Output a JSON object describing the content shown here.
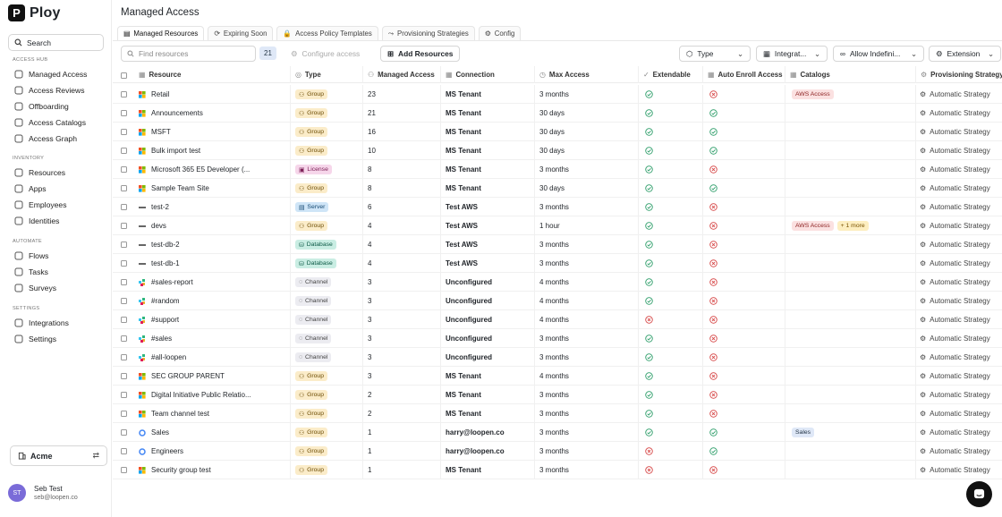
{
  "app": {
    "name": "Ploy",
    "logo_letter": "P"
  },
  "sidebar": {
    "search_label": "Search",
    "sections": [
      {
        "title": "ACCESS HUB",
        "items": [
          {
            "label": "Managed Access",
            "icon": "shield-icon"
          },
          {
            "label": "Access Reviews",
            "icon": "check-circle-icon"
          },
          {
            "label": "Offboarding",
            "icon": "logout-icon"
          },
          {
            "label": "Access Catalogs",
            "icon": "grid-icon"
          },
          {
            "label": "Access Graph",
            "icon": "graph-icon"
          }
        ]
      },
      {
        "title": "INVENTORY",
        "items": [
          {
            "label": "Resources",
            "icon": "box-icon"
          },
          {
            "label": "Apps",
            "icon": "apps-icon"
          },
          {
            "label": "Employees",
            "icon": "users-icon"
          },
          {
            "label": "Identities",
            "icon": "id-icon"
          }
        ]
      },
      {
        "title": "AUTOMATE",
        "items": [
          {
            "label": "Flows",
            "icon": "flow-icon"
          },
          {
            "label": "Tasks",
            "icon": "list-icon"
          },
          {
            "label": "Surveys",
            "icon": "survey-icon"
          }
        ]
      },
      {
        "title": "SETTINGS",
        "items": [
          {
            "label": "Integrations",
            "icon": "plug-icon"
          },
          {
            "label": "Settings",
            "icon": "gear-icon"
          }
        ]
      }
    ],
    "org": "Acme",
    "user": {
      "initials": "ST",
      "name": "Seb Test",
      "email": "seb@loopen.co"
    }
  },
  "page": {
    "title": "Managed Access"
  },
  "tabs": [
    "Managed Resources",
    "Expiring Soon",
    "Access Policy Templates",
    "Provisioning Strategies",
    "Config"
  ],
  "toolbar": {
    "find_placeholder": "Find resources",
    "count": "21",
    "configure_label": "Configure access",
    "add_label": "Add Resources",
    "filters": [
      "Type",
      "Integrat...",
      "Allow Indefini...",
      "Extension"
    ]
  },
  "columns": [
    "Resource",
    "Type",
    "Managed Access",
    "Connection",
    "Max Access",
    "Extendable",
    "Auto Enroll Access",
    "Catalogs",
    "Provisioning Strategy"
  ],
  "rows": [
    {
      "name": "Retail",
      "src": "ms",
      "type": "Group",
      "count": "23",
      "conn": "MS Tenant",
      "max": "3 months",
      "ext": true,
      "auto": false,
      "tags": [
        {
          "t": "AWS Access",
          "c": "red"
        }
      ],
      "prov": "Automatic Strategy"
    },
    {
      "name": "Announcements",
      "src": "ms",
      "type": "Group",
      "count": "21",
      "conn": "MS Tenant",
      "max": "30 days",
      "ext": true,
      "auto": true,
      "tags": [],
      "prov": "Automatic Strategy"
    },
    {
      "name": "MSFT",
      "src": "ms",
      "type": "Group",
      "count": "16",
      "conn": "MS Tenant",
      "max": "30 days",
      "ext": true,
      "auto": true,
      "tags": [],
      "prov": "Automatic Strategy"
    },
    {
      "name": "Bulk import test",
      "src": "ms",
      "type": "Group",
      "count": "10",
      "conn": "MS Tenant",
      "max": "30 days",
      "ext": true,
      "auto": true,
      "tags": [],
      "prov": "Automatic Strategy"
    },
    {
      "name": "Microsoft 365 E5 Developer (...",
      "src": "ms",
      "type": "License",
      "count": "8",
      "conn": "MS Tenant",
      "max": "3 months",
      "ext": true,
      "auto": false,
      "tags": [],
      "prov": "Automatic Strategy"
    },
    {
      "name": "Sample Team Site",
      "src": "ms",
      "type": "Group",
      "count": "8",
      "conn": "MS Tenant",
      "max": "30 days",
      "ext": true,
      "auto": true,
      "tags": [],
      "prov": "Automatic Strategy"
    },
    {
      "name": "test-2",
      "src": "aws",
      "type": "Server",
      "count": "6",
      "conn": "Test AWS",
      "max": "3 months",
      "ext": true,
      "auto": false,
      "tags": [],
      "prov": "Automatic Strategy"
    },
    {
      "name": "devs",
      "src": "aws",
      "type": "Group",
      "count": "4",
      "conn": "Test AWS",
      "max": "1 hour",
      "ext": true,
      "auto": false,
      "tags": [
        {
          "t": "AWS Access",
          "c": "red"
        },
        {
          "t": "+ 1 more",
          "c": "yellow"
        }
      ],
      "prov": "Automatic Strategy"
    },
    {
      "name": "test-db-2",
      "src": "aws",
      "type": "Database",
      "count": "4",
      "conn": "Test AWS",
      "max": "3 months",
      "ext": true,
      "auto": false,
      "tags": [],
      "prov": "Automatic Strategy"
    },
    {
      "name": "test-db-1",
      "src": "aws",
      "type": "Database",
      "count": "4",
      "conn": "Test AWS",
      "max": "3 months",
      "ext": true,
      "auto": false,
      "tags": [],
      "prov": "Automatic Strategy"
    },
    {
      "name": "#sales-report",
      "src": "slack",
      "type": "Channel",
      "count": "3",
      "conn": "Unconfigured",
      "max": "4 months",
      "ext": true,
      "auto": false,
      "tags": [],
      "prov": "Automatic Strategy"
    },
    {
      "name": "#random",
      "src": "slack",
      "type": "Channel",
      "count": "3",
      "conn": "Unconfigured",
      "max": "4 months",
      "ext": true,
      "auto": false,
      "tags": [],
      "prov": "Automatic Strategy"
    },
    {
      "name": "#support",
      "src": "slack",
      "type": "Channel",
      "count": "3",
      "conn": "Unconfigured",
      "max": "4 months",
      "ext": false,
      "auto": false,
      "tags": [],
      "prov": "Automatic Strategy"
    },
    {
      "name": "#sales",
      "src": "slack",
      "type": "Channel",
      "count": "3",
      "conn": "Unconfigured",
      "max": "3 months",
      "ext": true,
      "auto": false,
      "tags": [],
      "prov": "Automatic Strategy"
    },
    {
      "name": "#all-loopen",
      "src": "slack",
      "type": "Channel",
      "count": "3",
      "conn": "Unconfigured",
      "max": "3 months",
      "ext": true,
      "auto": false,
      "tags": [],
      "prov": "Automatic Strategy"
    },
    {
      "name": "SEC GROUP PARENT",
      "src": "ms",
      "type": "Group",
      "count": "3",
      "conn": "MS Tenant",
      "max": "4 months",
      "ext": true,
      "auto": false,
      "tags": [],
      "prov": "Automatic Strategy"
    },
    {
      "name": "Digital Initiative Public Relatio...",
      "src": "ms",
      "type": "Group",
      "count": "2",
      "conn": "MS Tenant",
      "max": "3 months",
      "ext": true,
      "auto": false,
      "tags": [],
      "prov": "Automatic Strategy"
    },
    {
      "name": "Team channel test",
      "src": "ms",
      "type": "Group",
      "count": "2",
      "conn": "MS Tenant",
      "max": "3 months",
      "ext": true,
      "auto": false,
      "tags": [],
      "prov": "Automatic Strategy"
    },
    {
      "name": "Sales",
      "src": "google",
      "type": "Group",
      "count": "1",
      "conn": "harry@loopen.co",
      "max": "3 months",
      "ext": true,
      "auto": true,
      "tags": [
        {
          "t": "Sales",
          "c": "blue"
        }
      ],
      "prov": "Automatic Strategy"
    },
    {
      "name": "Engineers",
      "src": "google",
      "type": "Group",
      "count": "1",
      "conn": "harry@loopen.co",
      "max": "3 months",
      "ext": false,
      "auto": true,
      "tags": [],
      "prov": "Automatic Strategy"
    },
    {
      "name": "Security group test",
      "src": "ms",
      "type": "Group",
      "count": "1",
      "conn": "MS Tenant",
      "max": "3 months",
      "ext": false,
      "auto": false,
      "tags": [],
      "prov": "Automatic Strategy"
    }
  ],
  "colors": {
    "ok": "#2e9e6a",
    "bad": "#d64545",
    "accent": "#7a6bd8"
  }
}
